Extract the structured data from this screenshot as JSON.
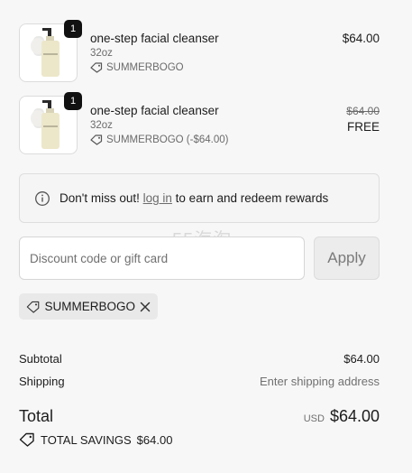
{
  "line_items": [
    {
      "quantity": "1",
      "name": "one-step facial cleanser",
      "size": "32oz",
      "discount_code": "SUMMERBOGO",
      "price": "$64.00"
    },
    {
      "quantity": "1",
      "name": "one-step facial cleanser",
      "size": "32oz",
      "discount_code": "SUMMERBOGO (-$64.00)",
      "price_original": "$64.00",
      "price": "FREE"
    }
  ],
  "notice": {
    "prefix": "Don't miss out!",
    "link": "log in",
    "suffix": "to earn and redeem rewards"
  },
  "discount": {
    "placeholder": "Discount code or gift card",
    "apply_label": "Apply",
    "applied_code": "SUMMERBOGO"
  },
  "summary": {
    "subtotal_label": "Subtotal",
    "subtotal_value": "$64.00",
    "shipping_label": "Shipping",
    "shipping_value": "Enter shipping address",
    "total_label": "Total",
    "currency": "USD",
    "total_value": "$64.00",
    "savings_label": "TOTAL SAVINGS",
    "savings_value": "$64.00"
  },
  "watermark": "55海淘",
  "icons": {
    "tag": "tag-icon",
    "info": "info-icon",
    "close": "close-icon"
  }
}
